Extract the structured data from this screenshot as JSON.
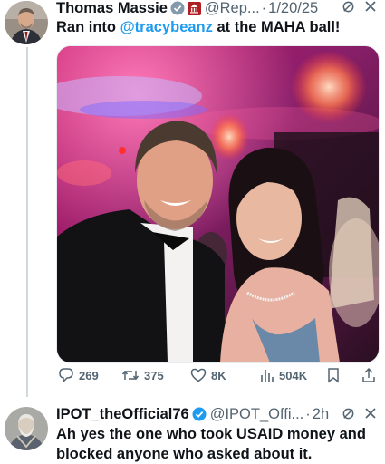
{
  "colors": {
    "link": "#1d9bf0",
    "muted": "#536471",
    "text": "#0f1419",
    "thread_line": "#cfd9de"
  },
  "tweet1": {
    "author_name": "Thomas Massie",
    "author_handle": "@Rep...",
    "separator": "·",
    "date": "1/20/25",
    "text_before": "Ran into ",
    "mention": "@tracybeanz",
    "text_after": " at the MAHA ball!",
    "stats": {
      "replies": "269",
      "reposts": "375",
      "likes": "8K",
      "views": "504K"
    },
    "icons": [
      "verified-badge-icon",
      "government-affiliate-icon",
      "grok-icon",
      "close-icon",
      "reply-icon",
      "repost-icon",
      "like-icon",
      "views-icon",
      "bookmark-icon",
      "share-icon"
    ]
  },
  "tweet2": {
    "author_name": "IPOT_theOfficial76",
    "author_handle": "@IPOT_Offi...",
    "separator": "·",
    "time": "2h",
    "text": "Ah yes the one who took USAID money and blocked anyone who asked about it."
  }
}
